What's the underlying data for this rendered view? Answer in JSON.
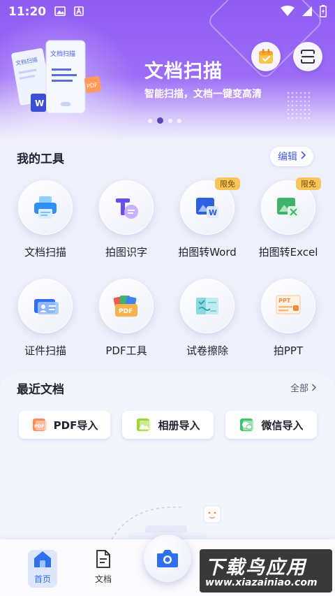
{
  "status_bar": {
    "time": "11:20"
  },
  "banner": {
    "title": "文档扫描",
    "subtitle": "智能扫描，文档一键变高清",
    "illustration_text_1": "文档扫描",
    "illustration_text_2": "文档扫描",
    "pdf_tag": "PDF",
    "word_tag": "W",
    "page_indicator": {
      "total": 4,
      "active": 2
    }
  },
  "tools": {
    "title": "我的工具",
    "edit_label": "编辑",
    "items": [
      {
        "label": "文档扫描",
        "icon": "printer-icon"
      },
      {
        "label": "拍图识字",
        "icon": "text-recognize-icon"
      },
      {
        "label": "拍图转Word",
        "icon": "word-icon",
        "badge": "限免"
      },
      {
        "label": "拍图转Excel",
        "icon": "excel-icon",
        "badge": "限免"
      },
      {
        "label": "证件扫描",
        "icon": "id-card-icon"
      },
      {
        "label": "PDF工具",
        "icon": "pdf-tool-icon",
        "icon_text": "PDF"
      },
      {
        "label": "试卷擦除",
        "icon": "exam-erase-icon"
      },
      {
        "label": "拍PPT",
        "icon": "ppt-icon",
        "icon_text": "PPT"
      }
    ]
  },
  "recent": {
    "title": "最近文档",
    "all_label": "全部",
    "imports": [
      {
        "label": "PDF导入",
        "icon": "pdf-import-icon",
        "icon_text": "PDF"
      },
      {
        "label": "相册导入",
        "icon": "album-import-icon"
      },
      {
        "label": "微信导入",
        "icon": "wechat-import-icon"
      }
    ]
  },
  "nav": {
    "home_label": "首页",
    "docs_label": "文档"
  },
  "watermark": {
    "main": "下载鸟应用",
    "url": "www.xiazainiao.com"
  },
  "colors": {
    "accent": "#4a5cf0",
    "banner_purple": "#8f5cf3",
    "badge": "#f7c55a"
  }
}
